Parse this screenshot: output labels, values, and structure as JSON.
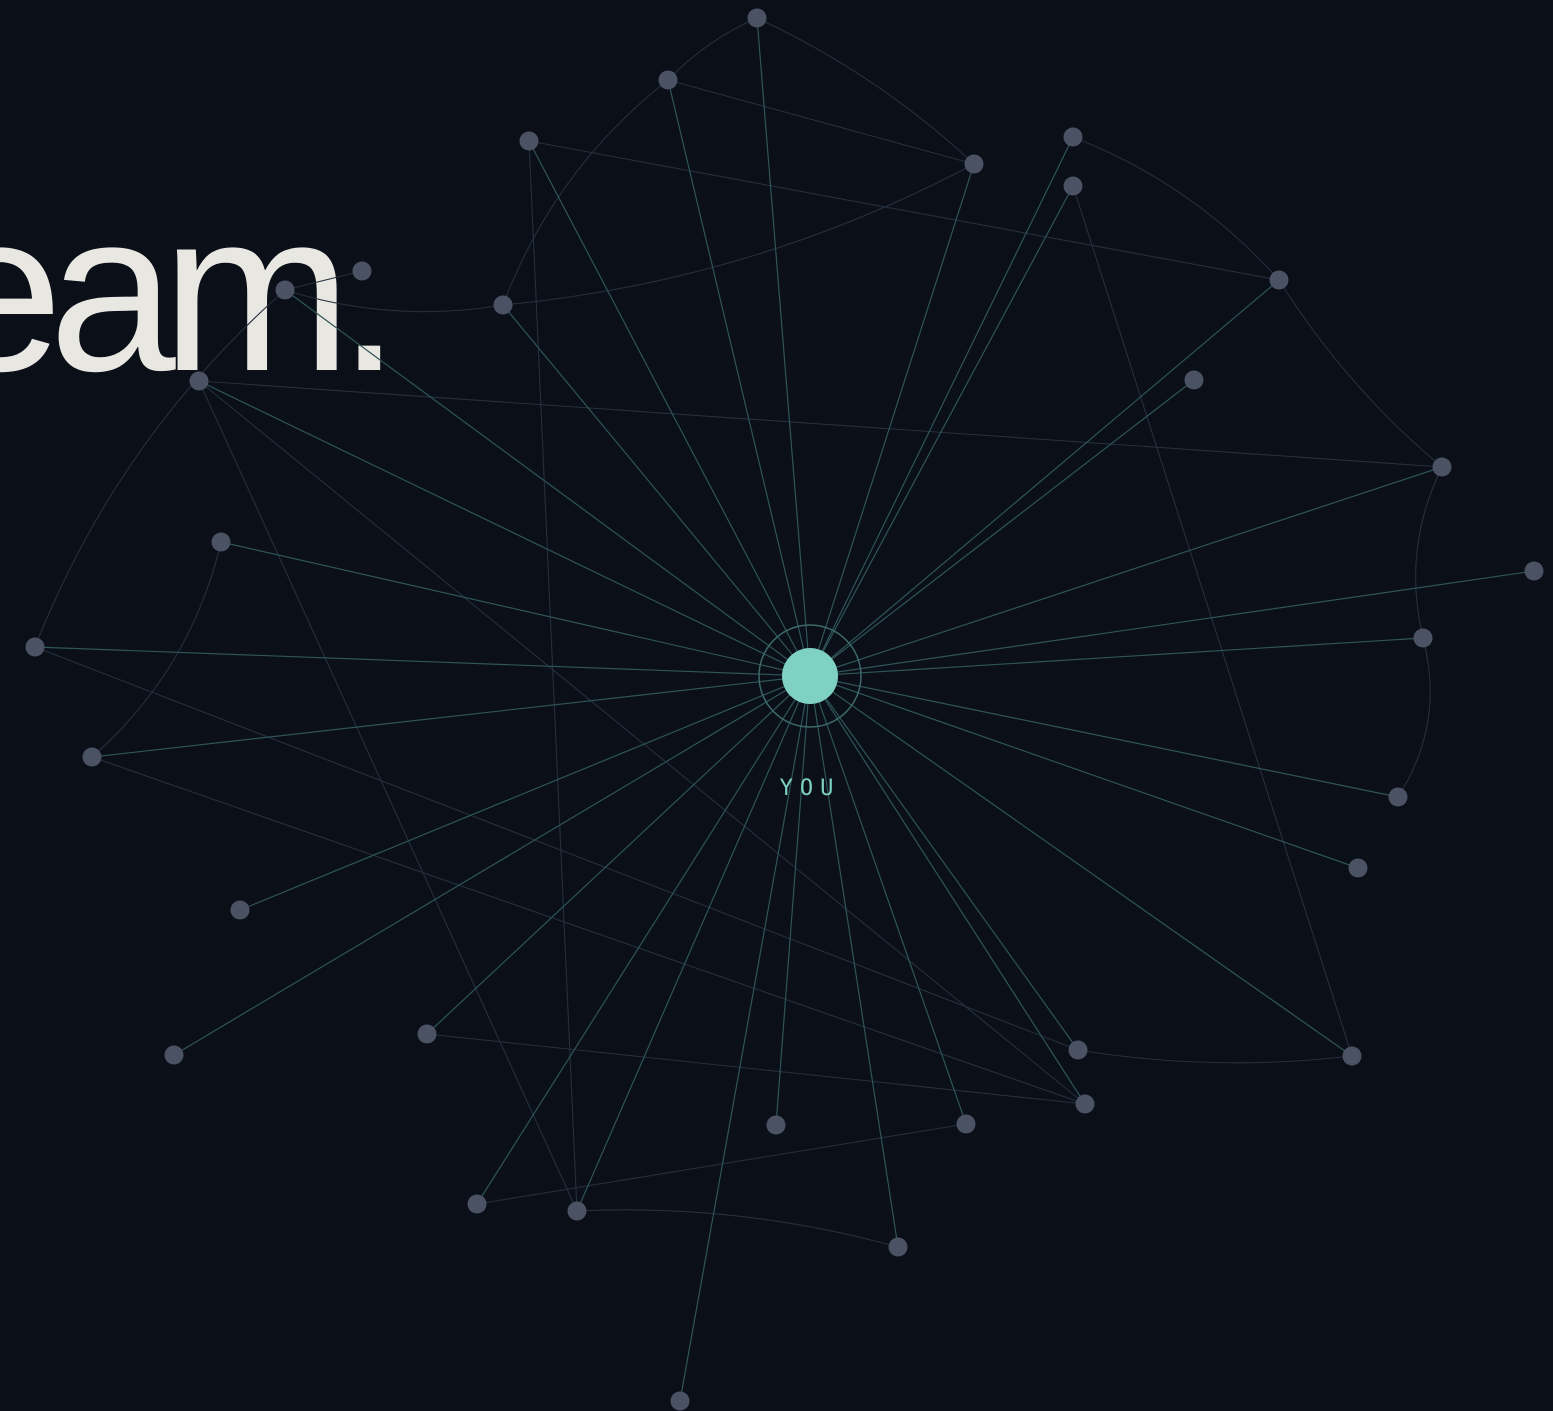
{
  "headline": {
    "text": "eam."
  },
  "network": {
    "center_label": "YOU",
    "colors": {
      "background": "#0a0f18",
      "headline": "#e9e7e2",
      "hub": "#7fd1c1",
      "hub_ring": "#3d6a68",
      "spoke": "#2f5558",
      "cross_link": "#25303d",
      "node": "#4b5263",
      "label": "#7fd1c1"
    }
  }
}
